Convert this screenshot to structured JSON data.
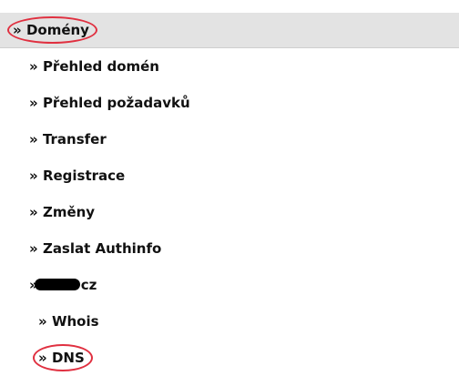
{
  "menu": {
    "header": {
      "prefix": "»",
      "label": "Domény"
    },
    "items": [
      {
        "prefix": "»",
        "label": "Přehled domén"
      },
      {
        "prefix": "»",
        "label": "Přehled požadavků"
      },
      {
        "prefix": "»",
        "label": "Transfer"
      },
      {
        "prefix": "»",
        "label": "Registrace"
      },
      {
        "prefix": "»",
        "label": "Změny"
      },
      {
        "prefix": "»",
        "label": "Zaslat Authinfo"
      }
    ],
    "domain_entry": {
      "prefix": "»",
      "redacted": true,
      "suffix": "cz"
    },
    "sub_items": [
      {
        "prefix": "»",
        "label": "Whois"
      },
      {
        "prefix": "»",
        "label": "DNS"
      }
    ]
  },
  "colors": {
    "highlight_ring": "#e03040",
    "header_bg": "#e3e3e3"
  }
}
